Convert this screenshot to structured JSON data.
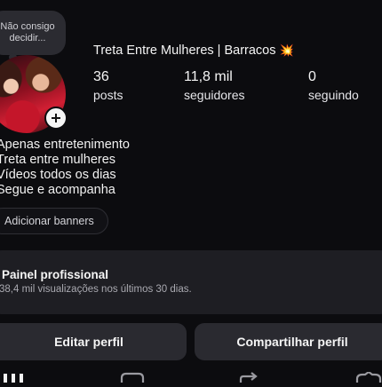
{
  "note": {
    "text": "Não consigo decidir..."
  },
  "profile": {
    "name": "Treta Entre Mulheres | Barracos",
    "name_emoji": "💥"
  },
  "stats": [
    {
      "value": "36",
      "label": "posts"
    },
    {
      "value": "11,8 mil",
      "label": "seguidores"
    },
    {
      "value": "0",
      "label": "seguindo"
    }
  ],
  "bio": {
    "lines": [
      "Apenas entretenimento",
      "Treta entre mulheres",
      "Vídeos todos os dias",
      "Segue e acompanha"
    ]
  },
  "banners_button": "Adicionar banners",
  "dashboard": {
    "title": "Painel profissional",
    "subtitle": "38,4 mil visualizações nos últimos 30 dias."
  },
  "actions": {
    "edit_profile": "Editar perfil",
    "share_profile": "Compartilhar perfil"
  },
  "icons": {
    "add": "plus-icon",
    "nav": [
      "grid-icon",
      "reels-icon",
      "repost-icon",
      "tagged-icon"
    ]
  }
}
